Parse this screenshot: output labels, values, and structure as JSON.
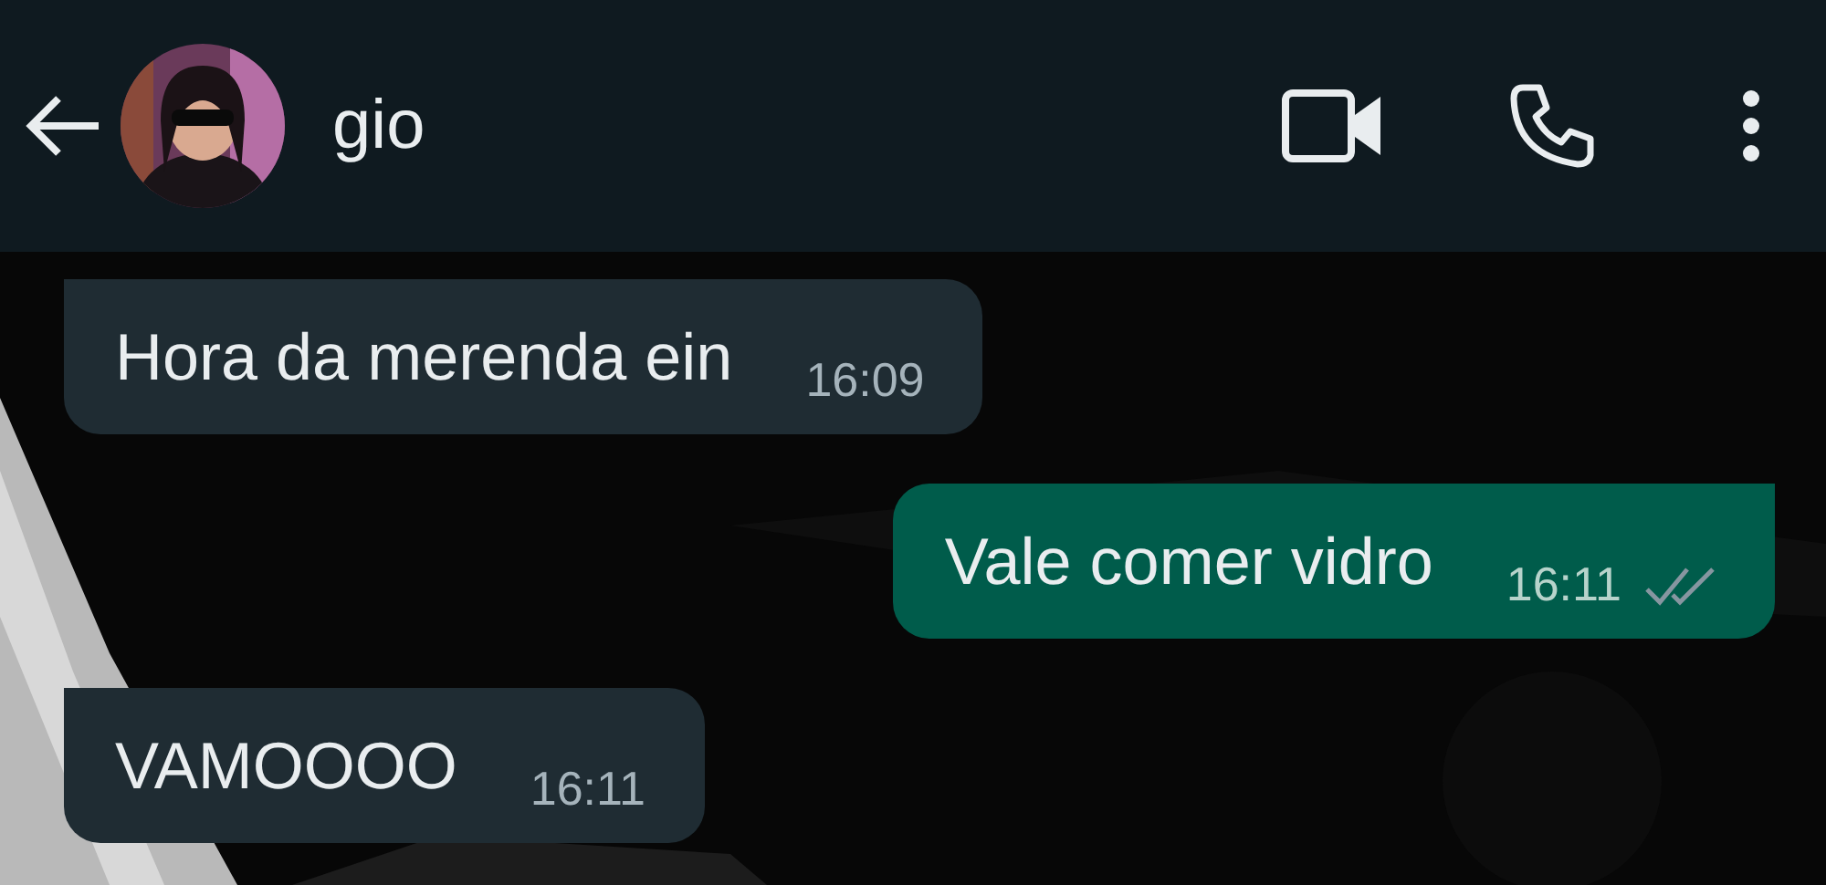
{
  "header": {
    "contact_name": "gio"
  },
  "messages": [
    {
      "outgoing": false,
      "text": "Hora da merenda ein",
      "time": "16:09"
    },
    {
      "outgoing": true,
      "text": "Vale comer vidro",
      "time": "16:11",
      "read": false
    },
    {
      "outgoing": false,
      "text": "VAMOOOO",
      "time": "16:11"
    }
  ]
}
